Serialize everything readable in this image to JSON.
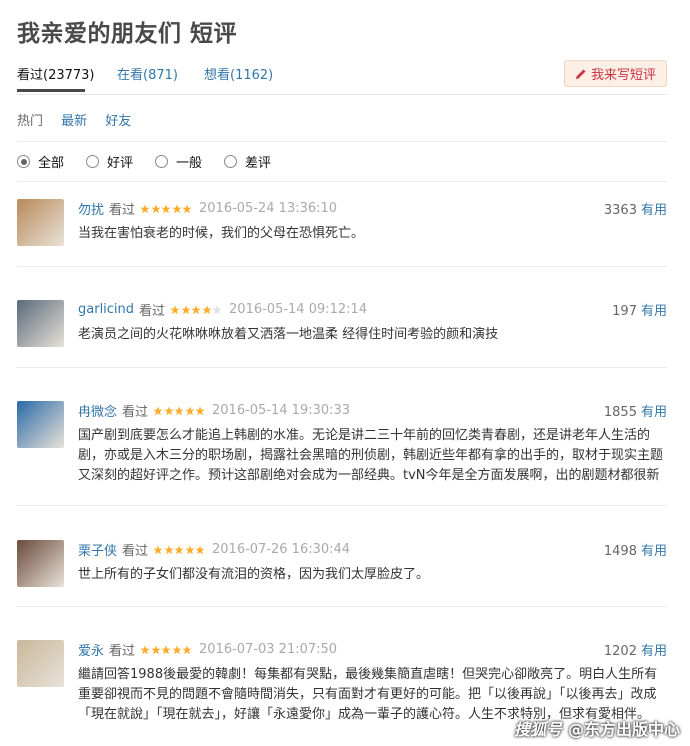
{
  "page": {
    "title": "我亲爱的朋友们 短评"
  },
  "tabs": [
    {
      "label": "看过(23773)",
      "active": true
    },
    {
      "label": "在看(871)",
      "active": false
    },
    {
      "label": "想看(1162)",
      "active": false
    }
  ],
  "write_button": {
    "label": "我来写短评",
    "icon": "pencil-icon"
  },
  "sort": {
    "items": [
      "热门",
      "最新",
      "好友"
    ],
    "selected": "热门"
  },
  "filters": {
    "items": [
      "全部",
      "好评",
      "一般",
      "差评"
    ],
    "selected": "全部"
  },
  "comments": [
    {
      "user": "勿扰",
      "status": "看过",
      "rating": 5,
      "time": "2016-05-24 13:36:10",
      "votes": "3363",
      "useful_label": "有用",
      "text": "当我在害怕衰老的时候，我们的父母在恐惧死亡。",
      "avatar_color": "#b88a5a"
    },
    {
      "user": "garlicind",
      "status": "看过",
      "rating": 4,
      "time": "2016-05-14 09:12:14",
      "votes": "197",
      "useful_label": "有用",
      "text": "老演员之间的火花咻咻咻放着又洒落一地温柔 经得住时间考验的颜和演技",
      "avatar_color": "#5a6a7a"
    },
    {
      "user": "冉微念",
      "status": "看过",
      "rating": 5,
      "time": "2016-05-14 19:30:33",
      "votes": "1855",
      "useful_label": "有用",
      "text": "国产剧到底要怎么才能追上韩剧的水准。无论是讲二三十年前的回忆类青春剧，还是讲老年人生活的剧，亦或是入木三分的职场剧，揭露社会黑暗的刑侦剧，韩剧近些年都有拿的出手的，取材于现实主题又深刻的超好评之作。预计这部剧绝对会成为一部经典。tvN今年是全方面发展啊，出的剧题材都很新",
      "avatar_color": "#2a6aa8"
    },
    {
      "user": "栗子侠",
      "status": "看过",
      "rating": 5,
      "time": "2016-07-26 16:30:44",
      "votes": "1498",
      "useful_label": "有用",
      "text": "世上所有的子女们都没有流泪的资格，因为我们太厚脸皮了。",
      "avatar_color": "#6a4a3a"
    },
    {
      "user": "爱永",
      "status": "看过",
      "rating": 5,
      "time": "2016-07-03 21:07:50",
      "votes": "1202",
      "useful_label": "有用",
      "text": "繼請回答1988後最愛的韓劇！每集都有哭點，最後幾集簡直虐瞎！但哭完心卻敞亮了。明白人生所有重要卻視而不見的問題不會隨時間消失，只有面對才有更好的可能。把「以後再說」「以後再去」改成「現在就說」「現在就去」，好讓「永遠愛你」成為一輩子的護心符。人生不求特別，但求有愛相伴。",
      "avatar_color": "#c9b79a"
    }
  ],
  "watermark": {
    "logo": "搜狐号",
    "text": "@东方出版中心"
  }
}
